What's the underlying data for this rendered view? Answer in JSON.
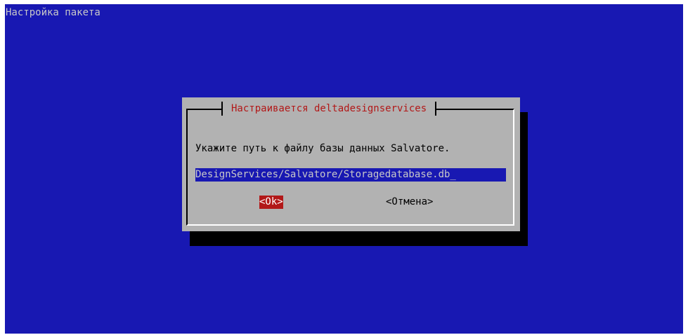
{
  "backtitle": "Настройка пакета",
  "dialog": {
    "title": "Настраивается deltadesignservices",
    "prompt": "Укажите путь к файлу базы данных Salvatore.",
    "input_value": "DesignServices/Salvatore/Storagedatabase.db_",
    "buttons": {
      "ok": "<Ok>",
      "cancel": "<Отмена>"
    }
  },
  "colors": {
    "background": "#1818b2",
    "dialog": "#b2b2b2",
    "title": "#b21818",
    "selected_button": "#b21818"
  }
}
